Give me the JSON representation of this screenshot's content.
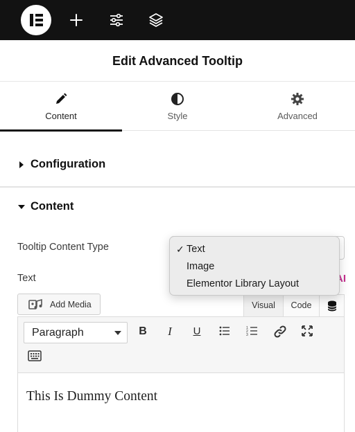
{
  "panel": {
    "title": "Edit Advanced Tooltip"
  },
  "tabs": [
    {
      "label": "Content",
      "active": true,
      "icon": "pencil-icon"
    },
    {
      "label": "Style",
      "active": false,
      "icon": "half-circle-icon"
    },
    {
      "label": "Advanced",
      "active": false,
      "icon": "gear-icon"
    }
  ],
  "sections": {
    "configuration": {
      "label": "Configuration",
      "expanded": false
    },
    "content": {
      "label": "Content",
      "expanded": true
    }
  },
  "fields": {
    "tooltip_content_type": {
      "label": "Tooltip Content Type",
      "selected": "Text"
    },
    "text": {
      "label": "Text"
    }
  },
  "dropdown": {
    "options": [
      "Text",
      "Image",
      "Elementor Library Layout"
    ],
    "checked_index": 0
  },
  "editor": {
    "add_media_label": "Add Media",
    "tab_visual": "Visual",
    "tab_code": "Code",
    "paragraph_format": "Paragraph",
    "content": "This Is Dummy Content"
  },
  "colors": {
    "topbar": "#121212",
    "accent_pink": "#c42f8e",
    "active_tab_underline": "#111111"
  }
}
